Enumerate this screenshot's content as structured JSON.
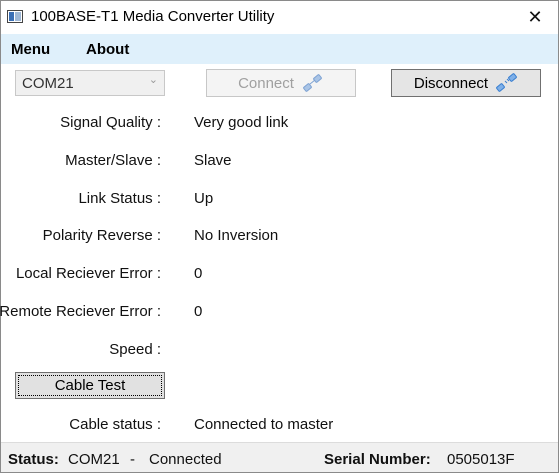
{
  "window": {
    "title": "100BASE-T1 Media Converter Utility",
    "close_glyph": "✕"
  },
  "menu": {
    "items": [
      {
        "label": "Menu"
      },
      {
        "label": "About"
      }
    ]
  },
  "toolbar": {
    "port": {
      "value": "COM21",
      "arrow": "⌄"
    },
    "connect_label": "Connect",
    "disconnect_label": "Disconnect"
  },
  "fields": [
    {
      "label": "Signal Quality :",
      "value": "Very good link"
    },
    {
      "label": "Master/Slave :",
      "value": "Slave"
    },
    {
      "label": "Link Status :",
      "value": "Up"
    },
    {
      "label": "Polarity Reverse :",
      "value": "No Inversion"
    },
    {
      "label": "Local Reciever Error :",
      "value": "0"
    },
    {
      "label": "Remote Reciever Error :",
      "value": "0"
    },
    {
      "label": "Speed :",
      "value": ""
    }
  ],
  "cable_test": {
    "button_label": "Cable Test",
    "status_label": "Cable status :",
    "status_value": "Connected to master"
  },
  "statusbar": {
    "status_label": "Status:",
    "port": "COM21",
    "separator": "-",
    "state": "Connected",
    "serial_label": "Serial Number:",
    "serial_value": "0505013F"
  },
  "colors": {
    "menubar_bg": "#dff0fb",
    "plug_icon": "#3a7fd0"
  }
}
